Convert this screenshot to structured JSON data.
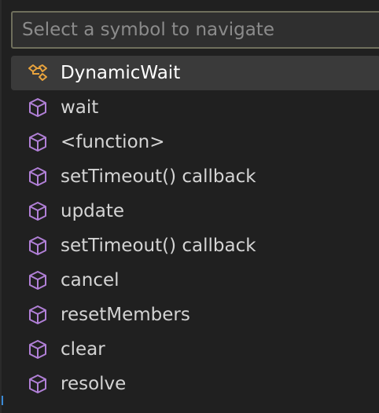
{
  "quick_pick": {
    "search": {
      "value": "",
      "placeholder": "Select a symbol to navigate"
    },
    "items": [
      {
        "label": "DynamicWait",
        "icon": "class-icon",
        "selected": true
      },
      {
        "label": "wait",
        "icon": "method-icon"
      },
      {
        "label": "<function>",
        "icon": "method-icon"
      },
      {
        "label": "setTimeout() callback",
        "icon": "method-icon"
      },
      {
        "label": "update",
        "icon": "method-icon"
      },
      {
        "label": "setTimeout() callback",
        "icon": "method-icon"
      },
      {
        "label": "cancel",
        "icon": "method-icon"
      },
      {
        "label": "resetMembers",
        "icon": "method-icon"
      },
      {
        "label": "clear",
        "icon": "method-icon"
      },
      {
        "label": "resolve",
        "icon": "method-icon"
      }
    ]
  },
  "colors": {
    "class_icon": "#e8a33d",
    "method_icon": "#b180d7",
    "selected_bg": "#3a3a3a"
  }
}
